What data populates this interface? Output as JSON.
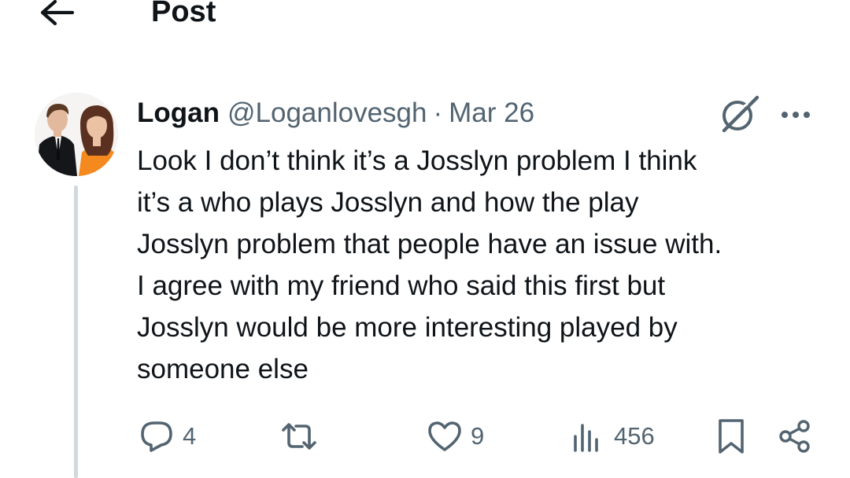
{
  "header": {
    "title": "Post",
    "back_icon": "arrow-left-icon"
  },
  "post": {
    "author_name": "Logan",
    "author_handle": "@Loganlovesgh",
    "separator": "·",
    "date": "Mar 26",
    "body_lines": [
      "Look I don’t think it’s a Josslyn problem I think",
      "it’s a who plays Josslyn and how the play",
      "Josslyn problem that people have an issue with.",
      "I agree with my friend who said this first but",
      "Josslyn would be more interesting played by",
      "someone else"
    ]
  },
  "actions": {
    "replies": "4",
    "reposts": "",
    "likes": "9",
    "views": "456"
  },
  "colors": {
    "text_primary": "#0f1419",
    "text_secondary": "#536471",
    "thread_line": "#cfd9de"
  }
}
